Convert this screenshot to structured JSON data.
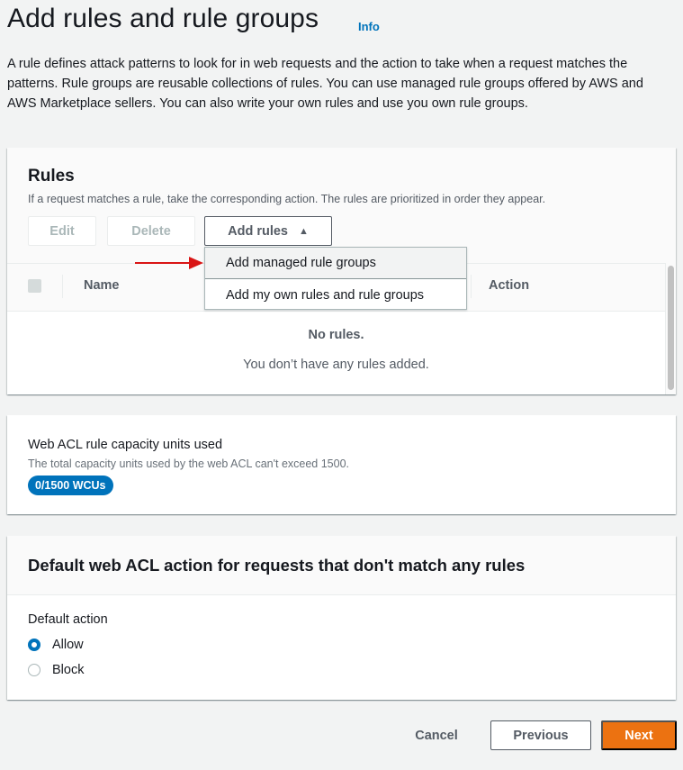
{
  "header": {
    "title": "Add rules and rule groups",
    "info_label": "Info",
    "intro": "A rule defines attack patterns to look for in web requests and the action to take when a request matches the patterns. Rule groups are reusable collections of rules. You can use managed rule groups offered by AWS and AWS Marketplace sellers. You can also write your own rules and use you own rule groups."
  },
  "rules": {
    "title": "Rules",
    "description": "If a request matches a rule, take the corresponding action. The rules are prioritized in order they appear.",
    "buttons": {
      "edit": "Edit",
      "delete": "Delete",
      "add_rules": "Add rules",
      "add_rules_caret": "▲"
    },
    "dropdown": {
      "items": [
        {
          "label": "Add managed rule groups",
          "highlighted": true
        },
        {
          "label": "Add my own rules and rule groups",
          "highlighted": false
        }
      ]
    },
    "table": {
      "columns": [
        "Name",
        "Action"
      ],
      "empty_title": "No rules.",
      "empty_description": "You don’t have any rules added."
    }
  },
  "capacity": {
    "title": "Web ACL rule capacity units used",
    "description": "The total capacity units used by the web ACL can't exceed 1500.",
    "badge": "0/1500 WCUs",
    "used": 0,
    "max": 1500
  },
  "default_action": {
    "title": "Default web ACL action for requests that don't match any rules",
    "label": "Default action",
    "options": [
      {
        "label": "Allow",
        "selected": true
      },
      {
        "label": "Block",
        "selected": false
      }
    ]
  },
  "footer": {
    "cancel": "Cancel",
    "previous": "Previous",
    "next": "Next"
  },
  "colors": {
    "primary": "#ec7211",
    "link": "#0073bb",
    "annotation_arrow": "#d91515"
  }
}
